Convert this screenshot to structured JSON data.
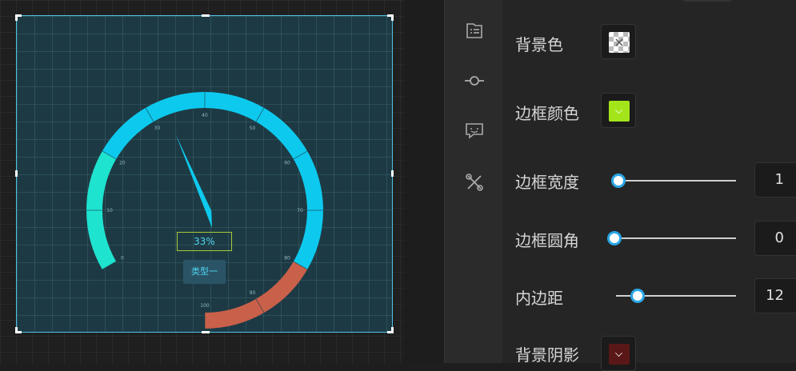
{
  "gauge": {
    "value_percent": 33,
    "value_text": "33%",
    "type_label": "类型一",
    "scale_min": 0,
    "scale_max": 100,
    "tick_labels": [
      "0",
      "10",
      "20",
      "30",
      "40",
      "50",
      "60",
      "70",
      "80",
      "90",
      "100"
    ],
    "segments": [
      {
        "from": 0,
        "to": 20,
        "color": "#1ee3cf"
      },
      {
        "from": 20,
        "to": 80,
        "color": "#0ec9ee"
      },
      {
        "from": 80,
        "to": 100,
        "color": "#c9604a"
      }
    ],
    "pointer_color": "#0ec9ee"
  },
  "rail": {
    "icons": [
      "list-icon",
      "connector-icon",
      "chat-icon",
      "tools-icon"
    ]
  },
  "properties": {
    "background_color": {
      "label": "背景色",
      "swatch": "transparent-checker"
    },
    "border_color": {
      "label": "边框颜色",
      "swatch": "#a3e41b"
    },
    "border_width": {
      "label": "边框宽度",
      "value": "1",
      "level": 0.0
    },
    "border_radius": {
      "label": "边框圆角",
      "value": "0",
      "level": 0.0
    },
    "padding": {
      "label": "内边距",
      "value": "12",
      "level": 0.12
    },
    "box_shadow": {
      "label": "背景阴影",
      "swatch": "#5a1717"
    }
  },
  "colors": {
    "accent": "#2aa6e6",
    "selection": "#4fc3e8"
  }
}
